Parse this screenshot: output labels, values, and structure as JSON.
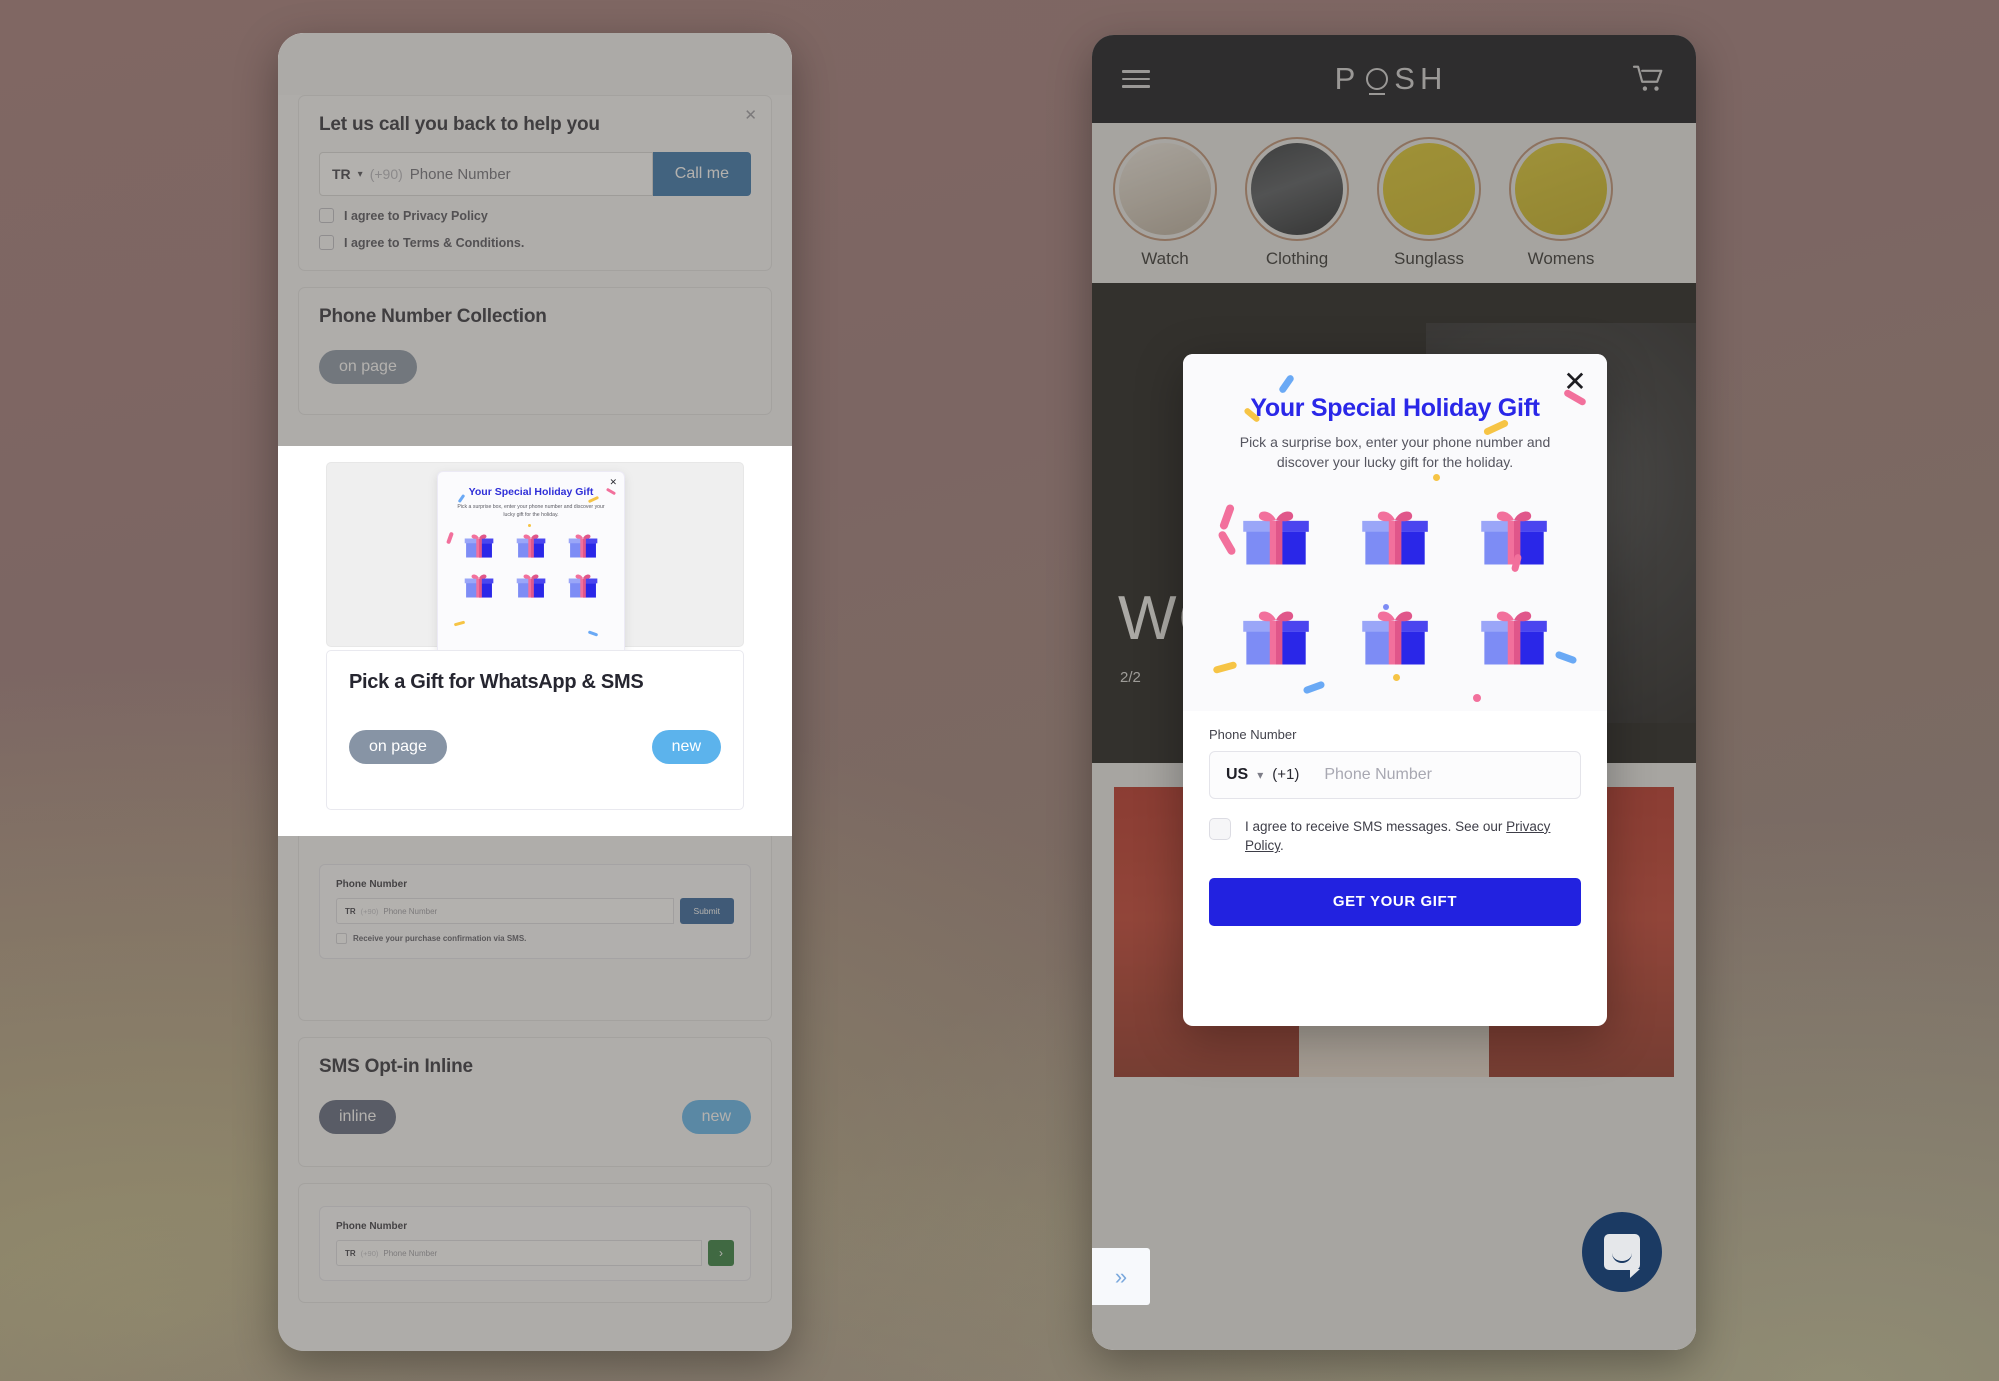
{
  "background": {
    "accent_mauve": "#7d6663",
    "accent_olive": "#969166"
  },
  "left_panel": {
    "callback_card": {
      "title": "Let us call you back to help you",
      "country_code": "TR",
      "dial_code": "(+90)",
      "phone_placeholder": "Phone Number",
      "cta": "Call me",
      "close_icon": "close-icon",
      "checkboxes": [
        "I agree to Privacy Policy",
        "I agree to Terms & Conditions."
      ]
    },
    "phone_collection_card": {
      "title": "Phone Number Collection",
      "badge_left": "on page"
    },
    "highlighted_card": {
      "preview_modal": {
        "title": "Your Special Holiday Gift",
        "subtitle": "Pick a surprise box, enter your phone number and discover your lucky gift for the holiday.",
        "close_icon": "close-icon",
        "gift_count": 6
      },
      "title": "Pick a Gift for WhatsApp & SMS",
      "badge_left": "on page",
      "badge_right": "new"
    },
    "sms_preview_card": {
      "field_label": "Phone Number",
      "country_code": "TR",
      "dial_code": "(+90)",
      "phone_placeholder": "Phone Number",
      "submit": "Submit",
      "consent": "Receive your purchase confirmation via SMS."
    },
    "sms_optin_card": {
      "title": "SMS Opt-in Inline",
      "badge_left": "inline",
      "badge_right": "new"
    },
    "bottom_preview_card": {
      "field_label": "Phone Number",
      "country_code": "TR",
      "dial_code": "(+90)",
      "phone_placeholder": "Phone Number",
      "arrow_label": "›"
    }
  },
  "right_panel": {
    "store": {
      "logo": "POSH",
      "menu_icon": "hamburger-menu-icon",
      "cart_icon": "shopping-cart-icon",
      "categories": [
        {
          "label": "Watch",
          "image": "img-watch"
        },
        {
          "label": "Clothing",
          "image": "img-cloth"
        },
        {
          "label": "Sunglass",
          "image": "img-sun"
        },
        {
          "label": "Womens",
          "image": "img-wom"
        }
      ],
      "hero_wordmark": "WO",
      "carousel_counter": "2/2",
      "chat_icon": "chat-bubble-icon",
      "expander_icon": "chevron-double-right-icon"
    },
    "modal": {
      "close_icon": "close-icon",
      "title": "Your Special Holiday Gift",
      "subtitle": "Pick a surprise box, enter your phone number and discover your lucky gift for the holiday.",
      "gift_count": 6,
      "gift_icon": "gift-box-icon",
      "field_label": "Phone Number",
      "country_code": "US",
      "dial_code": "(+1)",
      "phone_placeholder": "Phone Number",
      "chevron_icon": "chevron-down-icon",
      "consent_text": "I agree to receive SMS messages. See our",
      "privacy_link": "Privacy Policy",
      "consent_suffix": ".",
      "cta": "GET YOUR GIFT",
      "accent_color": "#2222e0"
    }
  }
}
